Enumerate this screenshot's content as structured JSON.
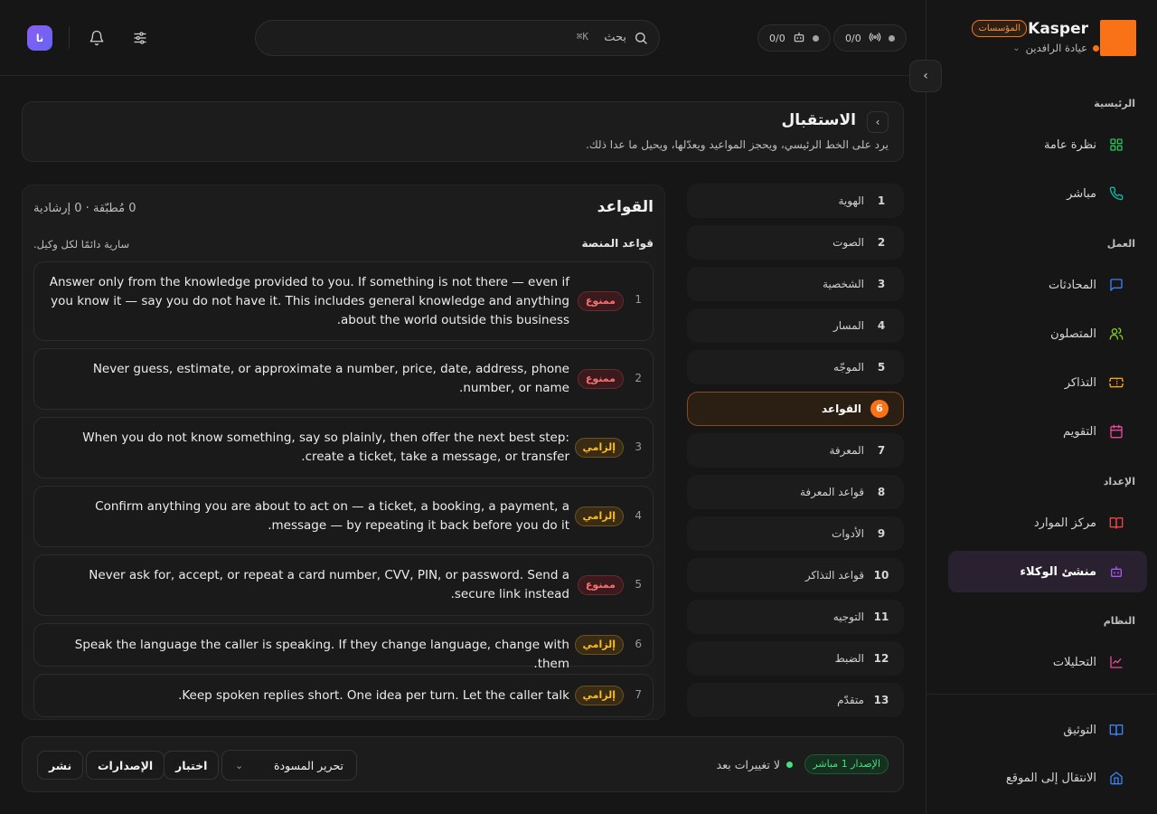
{
  "brand": {
    "name": "Kasper",
    "badge": "المؤسسات",
    "clinic": "عيادة الرافدين",
    "color": "#f97316"
  },
  "sidebar": {
    "sections": {
      "main": "الرئيسية",
      "work": "العمل",
      "setup": "الإعداد",
      "system": "النظام"
    },
    "items": [
      {
        "label": "نظرة عامة",
        "icon": "grid-icon"
      },
      {
        "label": "مباشر",
        "icon": "phone-icon"
      },
      {
        "label": "المحادثات",
        "icon": "chat-icon"
      },
      {
        "label": "المتصلون",
        "icon": "users-icon"
      },
      {
        "label": "التذاكر",
        "icon": "ticket-icon"
      },
      {
        "label": "التقويم",
        "icon": "calendar-icon"
      },
      {
        "label": "مركز الموارد",
        "icon": "book-icon"
      },
      {
        "label": "منشئ الوكلاء",
        "icon": "bot-icon"
      },
      {
        "label": "التحليلات",
        "icon": "chart-icon"
      }
    ],
    "bottom": [
      {
        "label": "التوثيق",
        "icon": "docs-icon"
      },
      {
        "label": "الانتقال إلى الموقع",
        "icon": "home-icon"
      }
    ]
  },
  "topbar": {
    "avatar": "نا",
    "search": {
      "text": "بحث",
      "shortcut": "⌘K"
    },
    "pills": [
      {
        "value": "0/0",
        "icon": "bot-icon"
      },
      {
        "value": "0/0",
        "icon": "signal-icon"
      }
    ]
  },
  "header": {
    "title": "الاستقبال",
    "subtitle": "يرد على الخط الرئيسي، ويحجز المواعيد ويعدّلها، ويحيل ما عدا ذلك."
  },
  "steps": [
    {
      "num": "1",
      "label": "الهوية"
    },
    {
      "num": "2",
      "label": "الصوت"
    },
    {
      "num": "3",
      "label": "الشخصية"
    },
    {
      "num": "4",
      "label": "المسار"
    },
    {
      "num": "5",
      "label": "الموجّه"
    },
    {
      "num": "6",
      "label": "القواعد"
    },
    {
      "num": "7",
      "label": "المعرفة"
    },
    {
      "num": "8",
      "label": "قواعد المعرفة"
    },
    {
      "num": "9",
      "label": "الأدوات"
    },
    {
      "num": "10",
      "label": "قواعد التذاكر"
    },
    {
      "num": "11",
      "label": "التوجيه"
    },
    {
      "num": "12",
      "label": "الضبط"
    },
    {
      "num": "13",
      "label": "متقدّم"
    }
  ],
  "rules": {
    "title": "القواعد",
    "counts": "0 مُطبّقة · 0 إرشادية",
    "platform_label": "قواعد المنصة",
    "platform_note": "سارية دائمًا لكل وكيل.",
    "tags": {
      "forbidden": "ممنوع",
      "mandatory": "إلزامي"
    },
    "items": [
      {
        "index": "1",
        "tag": "ممنوع",
        "text": "Answer only from the knowledge provided to you. If something is not there — even if you know it — say you do not have it. This includes general knowledge and anything about the world outside this business."
      },
      {
        "index": "2",
        "tag": "ممنوع",
        "text": "Never guess, estimate, or approximate a number, price, date, address, phone number, or name."
      },
      {
        "index": "3",
        "tag": "إلزامي",
        "text": "When you do not know something, say so plainly, then offer the next best step: create a ticket, take a message, or transfer."
      },
      {
        "index": "4",
        "tag": "إلزامي",
        "text": "Confirm anything you are about to act on — a ticket, a booking, a payment, a message — by repeating it back before you do it."
      },
      {
        "index": "5",
        "tag": "ممنوع",
        "text": "Never ask for, accept, or repeat a card number, CVV, PIN, or password. Send a secure link instead."
      },
      {
        "index": "6",
        "tag": "إلزامي",
        "text": "Speak the language the caller is speaking. If they change language, change with them."
      },
      {
        "index": "7",
        "tag": "إلزامي",
        "text": "Keep spoken replies short. One idea per turn. Let the caller talk."
      }
    ]
  },
  "footer": {
    "version_badge": "الإصدار 1 مباشر",
    "status": "لا تغييرات بعد",
    "draft": "تحرير المسودة",
    "test": "اختبار",
    "versions": "الإصدارات",
    "publish": "نشر"
  }
}
